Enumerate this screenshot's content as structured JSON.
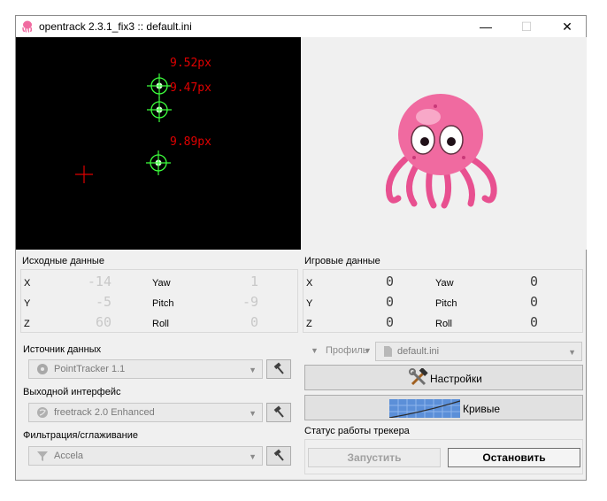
{
  "window": {
    "title": "opentrack 2.3.1_fix3 :: default.ini",
    "minimize_glyph": "—",
    "maximize_glyph": "☐",
    "close_glyph": "✕"
  },
  "video": {
    "points": [
      {
        "label": "9.52px"
      },
      {
        "label": "9.47px"
      },
      {
        "label": "9.89px"
      }
    ]
  },
  "raw": {
    "title": "Исходные данные",
    "x_label": "X",
    "x_value": "-14",
    "y_label": "Y",
    "y_value": "-5",
    "z_label": "Z",
    "z_value": "60",
    "yaw_label": "Yaw",
    "yaw_value": "1",
    "pitch_label": "Pitch",
    "pitch_value": "-9",
    "roll_label": "Roll",
    "roll_value": "0"
  },
  "game": {
    "title": "Игровые данные",
    "x_label": "X",
    "x_value": "0",
    "y_label": "Y",
    "y_value": "0",
    "z_label": "Z",
    "z_value": "0",
    "yaw_label": "Yaw",
    "yaw_value": "0",
    "pitch_label": "Pitch",
    "pitch_value": "0",
    "roll_label": "Roll",
    "roll_value": "0"
  },
  "source": {
    "title": "Источник данных",
    "value": "PointTracker 1.1"
  },
  "output": {
    "title": "Выходной интерфейс",
    "value": "freetrack 2.0 Enhanced"
  },
  "filter": {
    "title": "Фильтрация/сглаживание",
    "value": "Accela"
  },
  "profile": {
    "label": "Профиль",
    "value": "default.ini"
  },
  "buttons": {
    "settings": "Настройки",
    "curves": "Кривые",
    "start": "Запустить",
    "stop": "Остановить"
  },
  "status": {
    "title": "Статус работы трекера"
  },
  "colors": {
    "accent_green": "#3cff3c",
    "label_red": "#e00000",
    "octopus_pink": "#f06aa0"
  }
}
